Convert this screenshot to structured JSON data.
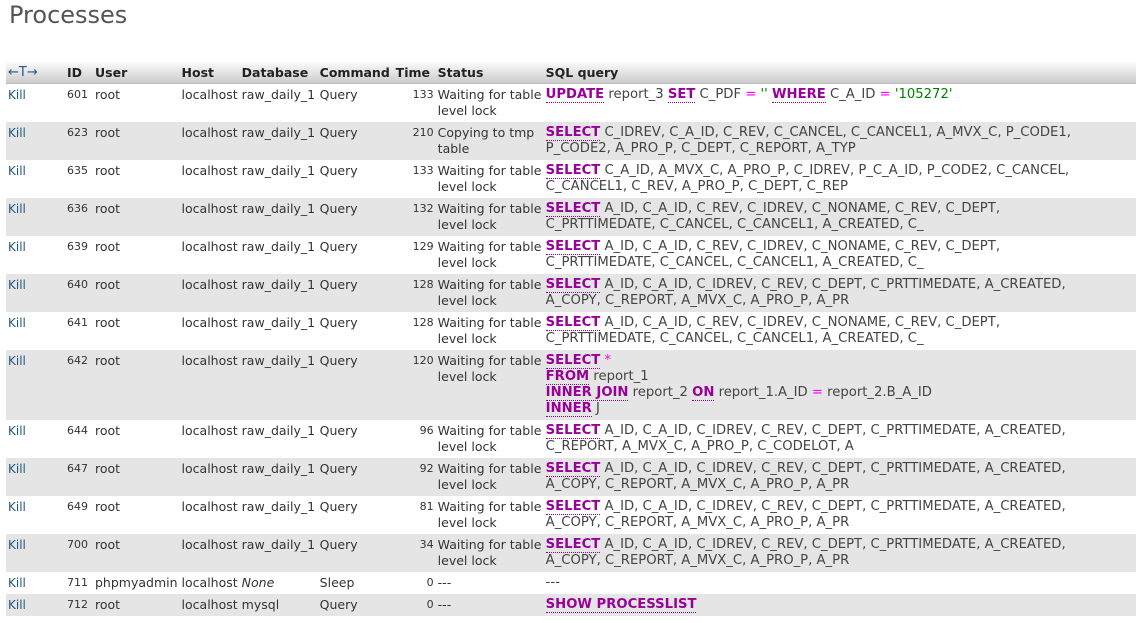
{
  "page": {
    "title": "Processes"
  },
  "table": {
    "sort_arrows": "←T→",
    "columns": [
      "ID",
      "User",
      "Host",
      "Database",
      "Command",
      "Time",
      "Status",
      "SQL query"
    ],
    "kill_label": "Kill",
    "rows": [
      {
        "id": "601",
        "user": "root",
        "host": "localhost",
        "db": "raw_daily_1",
        "db_italic": false,
        "command": "Query",
        "time": "133",
        "status": "Waiting for table level lock",
        "sql": [
          [
            [
              "kw",
              "UPDATE"
            ],
            [
              "t",
              " report_3 "
            ],
            [
              "kw",
              "SET"
            ],
            [
              "t",
              " C_PDF "
            ],
            [
              "op",
              "="
            ],
            [
              "t",
              " "
            ],
            [
              "str",
              "''"
            ],
            [
              "t",
              " "
            ],
            [
              "kw",
              "WHERE"
            ],
            [
              "t",
              " C_A_ID "
            ],
            [
              "op",
              "="
            ],
            [
              "t",
              " "
            ],
            [
              "str",
              "'105272'"
            ]
          ]
        ]
      },
      {
        "id": "623",
        "user": "root",
        "host": "localhost",
        "db": "raw_daily_1",
        "db_italic": false,
        "command": "Query",
        "time": "210",
        "status": "Copying to tmp table",
        "sql": [
          [
            [
              "kw",
              "SELECT"
            ],
            [
              "t",
              " C_IDREV, C_A_ID, C_REV, C_CANCEL, C_CANCEL1, A_MVX_C, P_CODE1,"
            ]
          ],
          [
            [
              "t",
              "P_CODE2, A_PRO_P, C_DEPT, C_REPORT, A_TYP"
            ]
          ]
        ]
      },
      {
        "id": "635",
        "user": "root",
        "host": "localhost",
        "db": "raw_daily_1",
        "db_italic": false,
        "command": "Query",
        "time": "133",
        "status": "Waiting for table level lock",
        "sql": [
          [
            [
              "kw",
              "SELECT"
            ],
            [
              "t",
              " C_A_ID, A_MVX_C, A_PRO_P, C_IDREV, P_C_A_ID, P_CODE2, C_CANCEL,"
            ]
          ],
          [
            [
              "t",
              "C_CANCEL1, C_REV, A_PRO_P, C_DEPT, C_REP"
            ]
          ]
        ]
      },
      {
        "id": "636",
        "user": "root",
        "host": "localhost",
        "db": "raw_daily_1",
        "db_italic": false,
        "command": "Query",
        "time": "132",
        "status": "Waiting for table level lock",
        "sql": [
          [
            [
              "kw",
              "SELECT"
            ],
            [
              "t",
              " A_ID, C_A_ID, C_REV, C_IDREV, C_NONAME, C_REV, C_DEPT,"
            ]
          ],
          [
            [
              "t",
              "C_PRTTIMEDATE, C_CANCEL, C_CANCEL1, A_CREATED, C_"
            ]
          ]
        ]
      },
      {
        "id": "639",
        "user": "root",
        "host": "localhost",
        "db": "raw_daily_1",
        "db_italic": false,
        "command": "Query",
        "time": "129",
        "status": "Waiting for table level lock",
        "sql": [
          [
            [
              "kw",
              "SELECT"
            ],
            [
              "t",
              " A_ID, C_A_ID, C_REV, C_IDREV, C_NONAME, C_REV, C_DEPT,"
            ]
          ],
          [
            [
              "t",
              "C_PRTTIMEDATE, C_CANCEL, C_CANCEL1, A_CREATED, C_"
            ]
          ]
        ]
      },
      {
        "id": "640",
        "user": "root",
        "host": "localhost",
        "db": "raw_daily_1",
        "db_italic": false,
        "command": "Query",
        "time": "128",
        "status": "Waiting for table level lock",
        "sql": [
          [
            [
              "kw",
              "SELECT"
            ],
            [
              "t",
              " A_ID, C_A_ID, C_IDREV, C_REV, C_DEPT, C_PRTTIMEDATE, A_CREATED,"
            ]
          ],
          [
            [
              "t",
              "A_COPY, C_REPORT, A_MVX_C, A_PRO_P, A_PR"
            ]
          ]
        ]
      },
      {
        "id": "641",
        "user": "root",
        "host": "localhost",
        "db": "raw_daily_1",
        "db_italic": false,
        "command": "Query",
        "time": "128",
        "status": "Waiting for table level lock",
        "sql": [
          [
            [
              "kw",
              "SELECT"
            ],
            [
              "t",
              " A_ID, C_A_ID, C_REV, C_IDREV, C_NONAME, C_REV, C_DEPT,"
            ]
          ],
          [
            [
              "t",
              "C_PRTTIMEDATE, C_CANCEL, C_CANCEL1, A_CREATED, C_"
            ]
          ]
        ]
      },
      {
        "id": "642",
        "user": "root",
        "host": "localhost",
        "db": "raw_daily_1",
        "db_italic": false,
        "command": "Query",
        "time": "120",
        "status": "Waiting for table level lock",
        "sql": [
          [
            [
              "kw",
              "SELECT"
            ],
            [
              "t",
              " "
            ],
            [
              "op",
              "*"
            ]
          ],
          [
            [
              "kw",
              "FROM"
            ],
            [
              "t",
              " report_1"
            ]
          ],
          [
            [
              "kw",
              "INNER JOIN"
            ],
            [
              "t",
              " report_2 "
            ],
            [
              "kw",
              "ON"
            ],
            [
              "t",
              " report_1.A_ID "
            ],
            [
              "op",
              "="
            ],
            [
              "t",
              " report_2.B_A_ID"
            ]
          ],
          [
            [
              "kw",
              "INNER"
            ],
            [
              "t",
              " J"
            ]
          ]
        ]
      },
      {
        "id": "644",
        "user": "root",
        "host": "localhost",
        "db": "raw_daily_1",
        "db_italic": false,
        "command": "Query",
        "time": "96",
        "status": "Waiting for table level lock",
        "sql": [
          [
            [
              "kw",
              "SELECT"
            ],
            [
              "t",
              " A_ID, C_A_ID, C_IDREV, C_REV, C_DEPT, C_PRTTIMEDATE, A_CREATED,"
            ]
          ],
          [
            [
              "t",
              "C_REPORT, A_MVX_C, A_PRO_P, C_CODELOT, A"
            ]
          ]
        ]
      },
      {
        "id": "647",
        "user": "root",
        "host": "localhost",
        "db": "raw_daily_1",
        "db_italic": false,
        "command": "Query",
        "time": "92",
        "status": "Waiting for table level lock",
        "sql": [
          [
            [
              "kw",
              "SELECT"
            ],
            [
              "t",
              " A_ID, C_A_ID, C_IDREV, C_REV, C_DEPT, C_PRTTIMEDATE, A_CREATED,"
            ]
          ],
          [
            [
              "t",
              "A_COPY, C_REPORT, A_MVX_C, A_PRO_P, A_PR"
            ]
          ]
        ]
      },
      {
        "id": "649",
        "user": "root",
        "host": "localhost",
        "db": "raw_daily_1",
        "db_italic": false,
        "command": "Query",
        "time": "81",
        "status": "Waiting for table level lock",
        "sql": [
          [
            [
              "kw",
              "SELECT"
            ],
            [
              "t",
              " A_ID, C_A_ID, C_IDREV, C_REV, C_DEPT, C_PRTTIMEDATE, A_CREATED,"
            ]
          ],
          [
            [
              "t",
              "A_COPY, C_REPORT, A_MVX_C, A_PRO_P, A_PR"
            ]
          ]
        ]
      },
      {
        "id": "700",
        "user": "root",
        "host": "localhost",
        "db": "raw_daily_1",
        "db_italic": false,
        "command": "Query",
        "time": "34",
        "status": "Waiting for table level lock",
        "sql": [
          [
            [
              "kw",
              "SELECT"
            ],
            [
              "t",
              " A_ID, C_A_ID, C_IDREV, C_REV, C_DEPT, C_PRTTIMEDATE, A_CREATED,"
            ]
          ],
          [
            [
              "t",
              "A_COPY, C_REPORT, A_MVX_C, A_PRO_P, A_PR"
            ]
          ]
        ]
      },
      {
        "id": "711",
        "user": "phpmyadmin",
        "host": "localhost",
        "db": "None",
        "db_italic": true,
        "command": "Sleep",
        "time": "0",
        "status": "---",
        "sql": [
          [
            [
              "t",
              "---"
            ]
          ]
        ]
      },
      {
        "id": "712",
        "user": "root",
        "host": "localhost",
        "db": "mysql",
        "db_italic": false,
        "command": "Query",
        "time": "0",
        "status": "---",
        "sql": [
          [
            [
              "kw",
              "SHOW PROCESSLIST"
            ]
          ]
        ]
      }
    ]
  }
}
